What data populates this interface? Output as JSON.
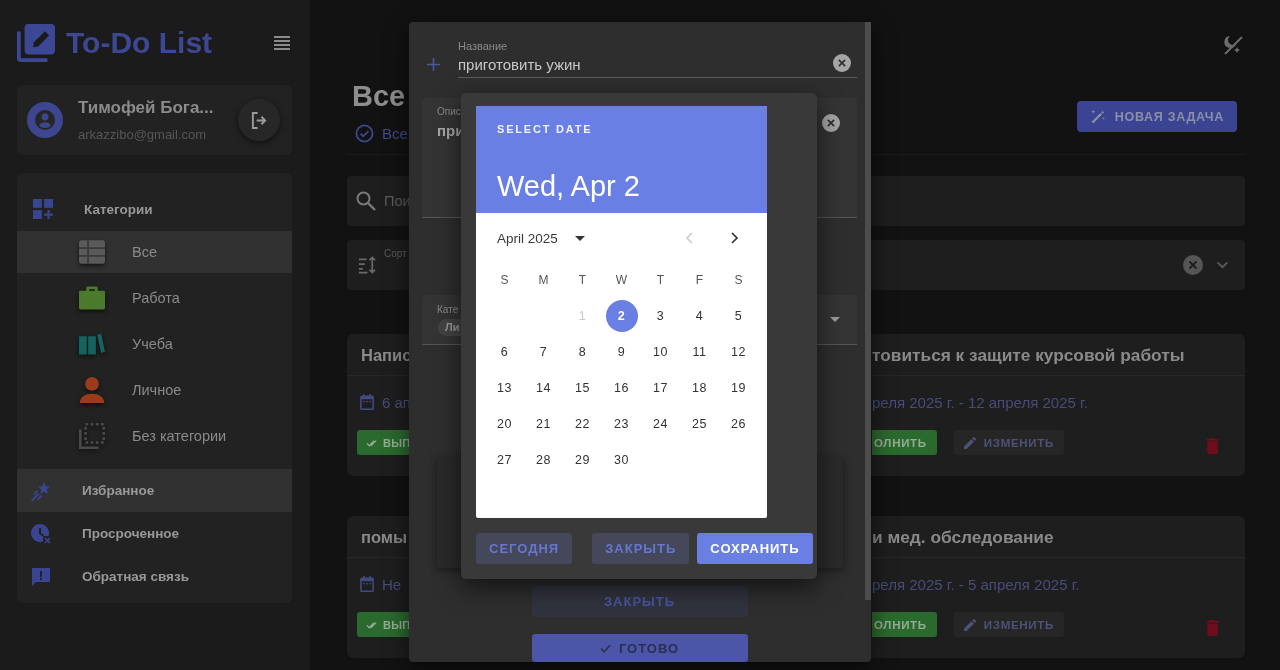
{
  "app": {
    "title": "To-Do List"
  },
  "user": {
    "name": "Тимофей Бога...",
    "email": "arkazzibo@gmail.com"
  },
  "sidebar": {
    "items": [
      {
        "label": "Категории",
        "kind": "categories",
        "selected": false,
        "children": [
          {
            "label": "Все",
            "kind": "all",
            "color": "#5a5a5a",
            "selected": true
          },
          {
            "label": "Работа",
            "kind": "work",
            "color": "#4b7a2c",
            "selected": false
          },
          {
            "label": "Учеба",
            "kind": "study",
            "color": "#16625e",
            "selected": false
          },
          {
            "label": "Личное",
            "kind": "personal",
            "color": "#9c3b1c",
            "selected": false
          },
          {
            "label": "Без категории",
            "kind": "none",
            "color": "#4a4a4a",
            "selected": false
          }
        ]
      },
      {
        "label": "Избранное",
        "kind": "favorites",
        "selected": true
      },
      {
        "label": "Просроченное",
        "kind": "overdue",
        "selected": false
      },
      {
        "label": "Обратная связь",
        "kind": "feedback",
        "selected": false
      }
    ]
  },
  "main": {
    "heading": "Все",
    "filter": "Все",
    "new_task_button": "НОВАЯ ЗАДАЧА",
    "search": {
      "placeholder": "Пои"
    },
    "sort": {
      "label": "Сорт"
    }
  },
  "tasks": [
    {
      "title": "Напис",
      "date": "6 ап",
      "complete_button": "ВЫП"
    },
    {
      "title": "товиться к защите курсовой работы",
      "date": "реля 2025 г. - 12 апреля 2025 г.",
      "complete_button": "ОЛНИТЬ",
      "edit_button": "ИЗМЕНИТЬ"
    },
    {
      "title": "помы",
      "date": "Не",
      "complete_button": "ВЫП"
    },
    {
      "title": "и мед. обследование",
      "date": "реля 2025 г. - 5 апреля 2025 г.",
      "complete_button": "ОЛНИТЬ",
      "edit_button": "ИЗМЕНИТЬ"
    }
  ],
  "task_editor": {
    "title_field": {
      "label": "Название",
      "value": "приготовить ужин"
    },
    "description_field": {
      "label": "Опис",
      "value": "при"
    },
    "category_field": {
      "label": "Кате",
      "chip": "Ли"
    },
    "buttons": [
      {
        "label": "ЗАКРЫТЬ",
        "kind": "secondary"
      },
      {
        "label": "ГОТОВО",
        "kind": "primary"
      }
    ]
  },
  "date_picker": {
    "caption": "SELECT DATE",
    "selected_date": "Wed, Apr 2",
    "month": "April 2025",
    "prev_disabled": true,
    "weekdays": [
      "S",
      "M",
      "T",
      "W",
      "T",
      "F",
      "S"
    ],
    "weeks": [
      [
        {
          "day": "1",
          "selected": false,
          "disabled": true
        },
        {
          "day": "2",
          "selected": true,
          "disabled": false
        },
        {
          "day": "3",
          "selected": false,
          "disabled": false
        },
        {
          "day": "4",
          "selected": false,
          "disabled": false
        },
        {
          "day": "5",
          "selected": false,
          "disabled": false
        }
      ],
      [
        {
          "day": "6",
          "selected": false,
          "disabled": false
        },
        {
          "day": "7",
          "selected": false,
          "disabled": false
        },
        {
          "day": "8",
          "selected": false,
          "disabled": false
        },
        {
          "day": "9",
          "selected": false,
          "disabled": false
        },
        {
          "day": "10",
          "selected": false,
          "disabled": false
        },
        {
          "day": "11",
          "selected": false,
          "disabled": false
        },
        {
          "day": "12",
          "selected": false,
          "disabled": false
        }
      ],
      [
        {
          "day": "13",
          "selected": false,
          "disabled": false
        },
        {
          "day": "14",
          "selected": false,
          "disabled": false
        },
        {
          "day": "15",
          "selected": false,
          "disabled": false
        },
        {
          "day": "16",
          "selected": false,
          "disabled": false
        },
        {
          "day": "17",
          "selected": false,
          "disabled": false
        },
        {
          "day": "18",
          "selected": false,
          "disabled": false
        },
        {
          "day": "19",
          "selected": false,
          "disabled": false
        }
      ],
      [
        {
          "day": "20",
          "selected": false,
          "disabled": false
        },
        {
          "day": "21",
          "selected": false,
          "disabled": false
        },
        {
          "day": "22",
          "selected": false,
          "disabled": false
        },
        {
          "day": "23",
          "selected": false,
          "disabled": false
        },
        {
          "day": "24",
          "selected": false,
          "disabled": false
        },
        {
          "day": "25",
          "selected": false,
          "disabled": false
        },
        {
          "day": "26",
          "selected": false,
          "disabled": false
        }
      ],
      [
        {
          "day": "27",
          "selected": false,
          "disabled": false
        },
        {
          "day": "28",
          "selected": false,
          "disabled": false
        },
        {
          "day": "29",
          "selected": false,
          "disabled": false
        },
        {
          "day": "30",
          "selected": false,
          "disabled": false
        }
      ]
    ],
    "buttons": [
      {
        "label": "СЕГОДНЯ",
        "kind": "secondary"
      },
      {
        "label": "ЗАКРЫТЬ",
        "kind": "secondary"
      },
      {
        "label": "СОХРАНИТЬ",
        "kind": "primary"
      }
    ]
  }
}
